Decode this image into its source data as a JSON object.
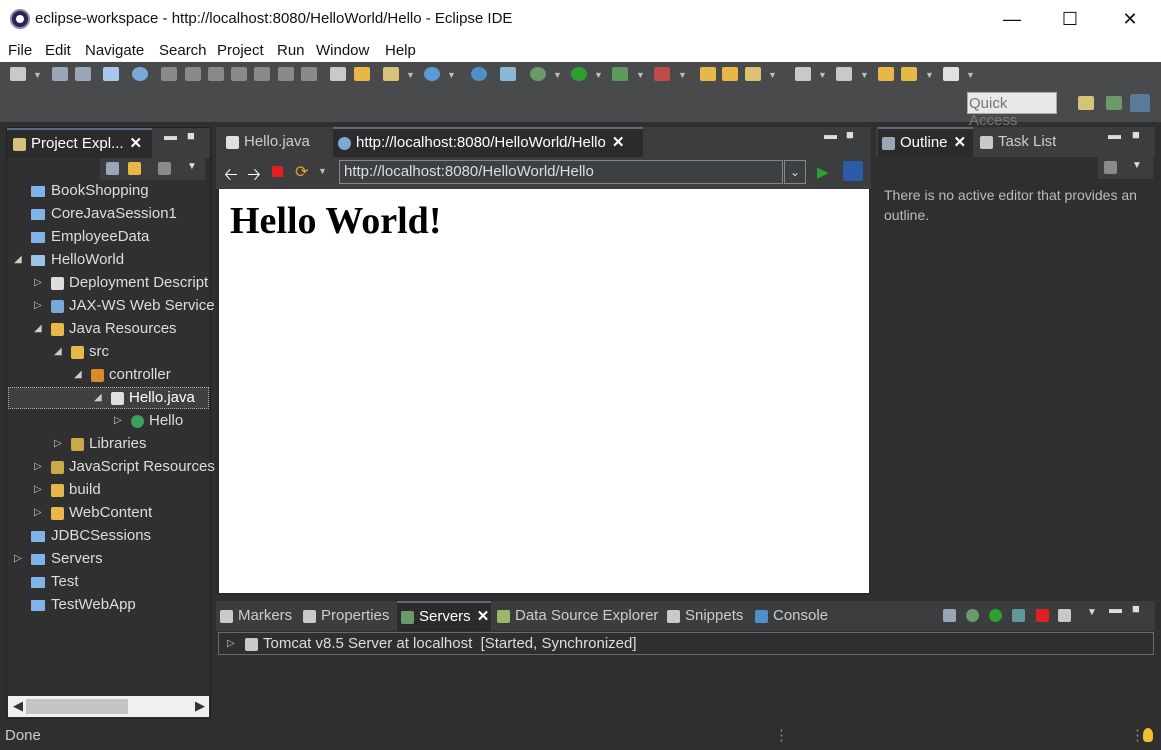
{
  "window": {
    "title": "eclipse-workspace - http://localhost:8080/HelloWorld/Hello - Eclipse IDE"
  },
  "menu": [
    "File",
    "Edit",
    "Navigate",
    "Search",
    "Project",
    "Run",
    "Window",
    "Help"
  ],
  "toolbar": {
    "quick_access_placeholder": "Quick Access"
  },
  "project_explorer": {
    "tab_label": "Project Expl...",
    "items": [
      {
        "label": "BookShopping"
      },
      {
        "label": "CoreJavaSession1"
      },
      {
        "label": "EmployeeData"
      },
      {
        "label": "HelloWorld"
      },
      {
        "label": "Deployment Descript"
      },
      {
        "label": "JAX-WS Web Service"
      },
      {
        "label": "Java Resources"
      },
      {
        "label": "src"
      },
      {
        "label": "controller"
      },
      {
        "label": "Hello.java"
      },
      {
        "label": "Hello"
      },
      {
        "label": "Libraries"
      },
      {
        "label": "JavaScript Resources"
      },
      {
        "label": "build"
      },
      {
        "label": "WebContent"
      },
      {
        "label": "JDBCSessions"
      },
      {
        "label": "Servers"
      },
      {
        "label": "Test"
      },
      {
        "label": "TestWebApp"
      }
    ]
  },
  "editor": {
    "tabs": [
      {
        "label": "Hello.java"
      },
      {
        "label": "http://localhost:8080/HelloWorld/Hello"
      }
    ],
    "url": "http://localhost:8080/HelloWorld/Hello",
    "page_heading": "Hello World!"
  },
  "outline": {
    "tabs": [
      {
        "label": "Outline"
      },
      {
        "label": "Task List"
      }
    ],
    "message": "There is no active editor that provides an outline."
  },
  "bottom": {
    "tabs": [
      {
        "label": "Markers"
      },
      {
        "label": "Properties"
      },
      {
        "label": "Servers"
      },
      {
        "label": "Data Source Explorer"
      },
      {
        "label": "Snippets"
      },
      {
        "label": "Console"
      }
    ],
    "server_entry": "Tomcat v8.5 Server at localhost  [Started, Synchronized]"
  },
  "status": {
    "text": "Done"
  },
  "colors": {
    "accent": "#5a6a80",
    "folder": "#7fb4ea",
    "run_green": "#2e9e2e",
    "stop_red": "#e02020"
  }
}
